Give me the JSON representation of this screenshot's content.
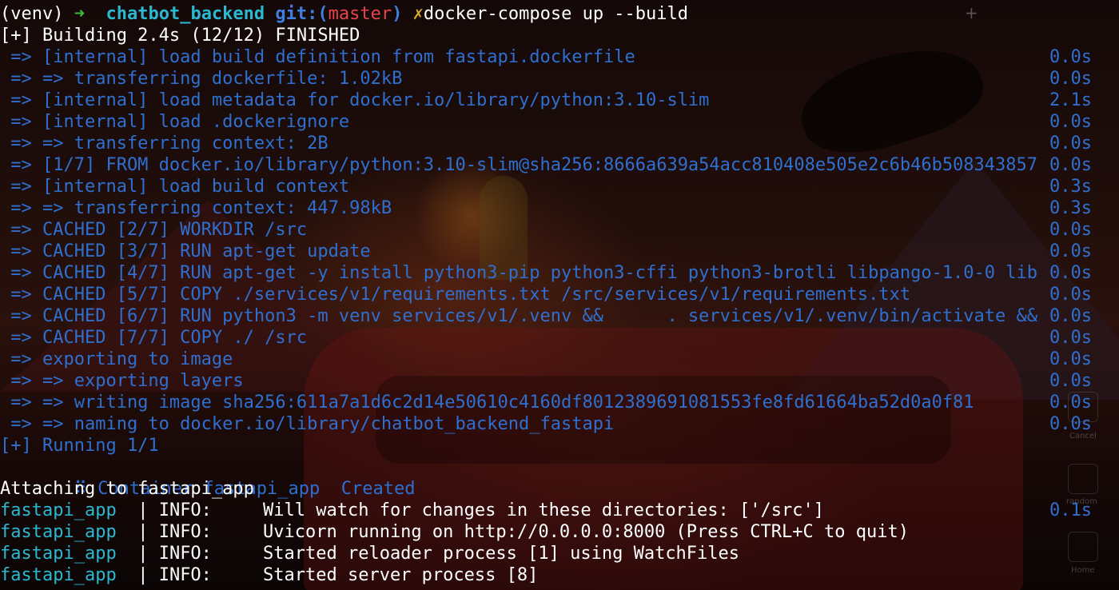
{
  "prompt": {
    "venv": "(venv)",
    "arrow": "➜",
    "dir": "chatbot_backend",
    "git_prefix": "git:(",
    "branch": "master",
    "git_suffix": ")",
    "dirty_mark": "✗",
    "command": "docker-compose up --build"
  },
  "build_header": "[+] Building 2.4s (12/12) FINISHED",
  "build_steps": [
    {
      "text": " => [internal] load build definition from fastapi.dockerfile",
      "time": "0.0s"
    },
    {
      "text": " => => transferring dockerfile: 1.02kB",
      "time": "0.0s"
    },
    {
      "text": " => [internal] load metadata for docker.io/library/python:3.10-slim",
      "time": "2.1s"
    },
    {
      "text": " => [internal] load .dockerignore",
      "time": "0.0s"
    },
    {
      "text": " => => transferring context: 2B",
      "time": "0.0s"
    },
    {
      "text": " => [1/7] FROM docker.io/library/python:3.10-slim@sha256:8666a639a54acc810408e505e2c6b46b508343857",
      "time": "0.0s"
    },
    {
      "text": " => [internal] load build context",
      "time": "0.3s"
    },
    {
      "text": " => => transferring context: 447.98kB",
      "time": "0.3s"
    },
    {
      "text": " => CACHED [2/7] WORKDIR /src",
      "time": "0.0s"
    },
    {
      "text": " => CACHED [3/7] RUN apt-get update",
      "time": "0.0s"
    },
    {
      "text": " => CACHED [4/7] RUN apt-get -y install python3-pip python3-cffi python3-brotli libpango-1.0-0 lib",
      "time": "0.0s"
    },
    {
      "text": " => CACHED [5/7] COPY ./services/v1/requirements.txt /src/services/v1/requirements.txt",
      "time": "0.0s"
    },
    {
      "text": " => CACHED [6/7] RUN python3 -m venv services/v1/.venv &&      . services/v1/.venv/bin/activate &&",
      "time": "0.0s"
    },
    {
      "text": " => CACHED [7/7] COPY ./ /src",
      "time": "0.0s"
    },
    {
      "text": " => exporting to image",
      "time": "0.0s"
    },
    {
      "text": " => => exporting layers",
      "time": "0.0s"
    },
    {
      "text": " => => writing image sha256:611a7a1d6c2d14e50610c4160df8012389691081553fe8fd61664ba52d0a0f81",
      "time": "0.0s"
    },
    {
      "text": " => => naming to docker.io/library/chatbot_backend_fastapi",
      "time": "0.0s"
    }
  ],
  "running_header": "[+] Running 1/1",
  "container_line": {
    "text": " ⠿ Container fastapi_app  Created",
    "time": "0.1s"
  },
  "attach_line": "Attaching to fastapi_app",
  "log_lines": [
    {
      "service": "fastapi_app",
      "sep": " | ",
      "level": "INFO:",
      "message": "Will watch for changes in these directories: ['/src']"
    },
    {
      "service": "fastapi_app",
      "sep": " | ",
      "level": "INFO:",
      "message": "Uvicorn running on http://0.0.0.0:8000 (Press CTRL+C to quit)"
    },
    {
      "service": "fastapi_app",
      "sep": " | ",
      "level": "INFO:",
      "message": "Started reloader process [1] using WatchFiles"
    },
    {
      "service": "fastapi_app",
      "sep": " | ",
      "level": "INFO:",
      "message": "Started server process [8]"
    }
  ],
  "dock": {
    "labels": [
      "Cancel",
      "random",
      "Home"
    ]
  },
  "colors": {
    "step_blue": "#2f6fcf",
    "prompt_green": "#3bbf3b",
    "dir_cyan": "#2bb8d0",
    "branch_red": "#e8434d",
    "dirty_yellow": "#d9a92e"
  }
}
